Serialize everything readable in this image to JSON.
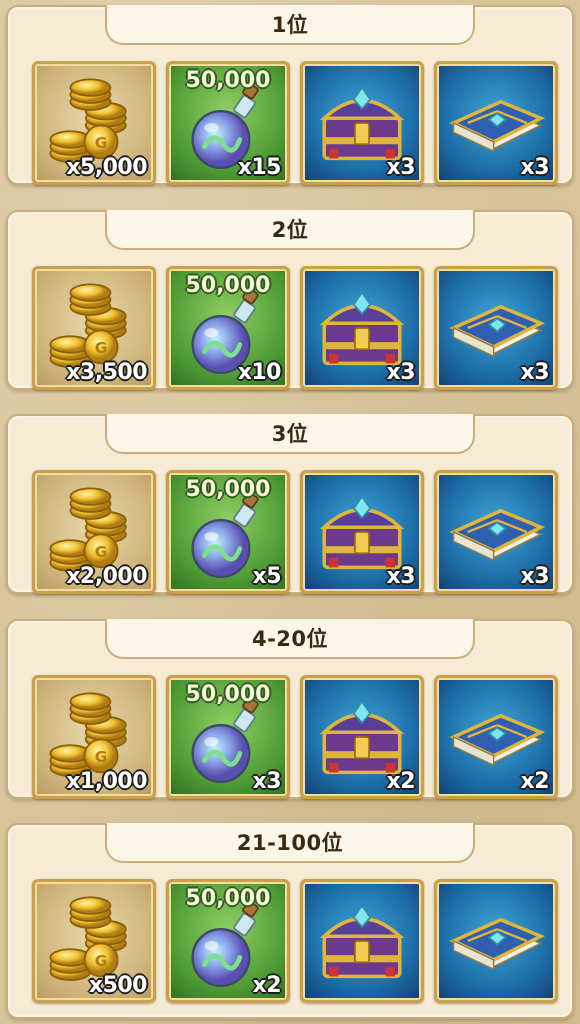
{
  "colors": {
    "page_background": "#d8c49a",
    "panel_background": "#f6ecd6",
    "panel_border": "#c9ad7c",
    "item_frame": "#caa04c",
    "quantity_text": "#ffffff"
  },
  "tiers": [
    {
      "rank": "1位",
      "rewards": [
        {
          "type": "coins",
          "icon": "gold-coins-icon",
          "quantity": "x5,000"
        },
        {
          "type": "potion",
          "icon": "potion-flask-icon",
          "amount": "50,000",
          "quantity": "x15"
        },
        {
          "type": "chest",
          "icon": "treasure-chest-icon",
          "quantity": "x3"
        },
        {
          "type": "book",
          "icon": "spell-book-icon",
          "quantity": "x3"
        }
      ]
    },
    {
      "rank": "2位",
      "rewards": [
        {
          "type": "coins",
          "icon": "gold-coins-icon",
          "quantity": "x3,500"
        },
        {
          "type": "potion",
          "icon": "potion-flask-icon",
          "amount": "50,000",
          "quantity": "x10"
        },
        {
          "type": "chest",
          "icon": "treasure-chest-icon",
          "quantity": "x3"
        },
        {
          "type": "book",
          "icon": "spell-book-icon",
          "quantity": "x3"
        }
      ]
    },
    {
      "rank": "3位",
      "rewards": [
        {
          "type": "coins",
          "icon": "gold-coins-icon",
          "quantity": "x2,000"
        },
        {
          "type": "potion",
          "icon": "potion-flask-icon",
          "amount": "50,000",
          "quantity": "x5"
        },
        {
          "type": "chest",
          "icon": "treasure-chest-icon",
          "quantity": "x3"
        },
        {
          "type": "book",
          "icon": "spell-book-icon",
          "quantity": "x3"
        }
      ]
    },
    {
      "rank": "4-20位",
      "rewards": [
        {
          "type": "coins",
          "icon": "gold-coins-icon",
          "quantity": "x1,000"
        },
        {
          "type": "potion",
          "icon": "potion-flask-icon",
          "amount": "50,000",
          "quantity": "x3"
        },
        {
          "type": "chest",
          "icon": "treasure-chest-icon",
          "quantity": "x2"
        },
        {
          "type": "book",
          "icon": "spell-book-icon",
          "quantity": "x2"
        }
      ]
    },
    {
      "rank": "21-100位",
      "rewards": [
        {
          "type": "coins",
          "icon": "gold-coins-icon",
          "quantity": "x500"
        },
        {
          "type": "potion",
          "icon": "potion-flask-icon",
          "amount": "50,000",
          "quantity": "x2"
        },
        {
          "type": "chest",
          "icon": "treasure-chest-icon",
          "quantity": ""
        },
        {
          "type": "book",
          "icon": "spell-book-icon",
          "quantity": ""
        }
      ]
    }
  ]
}
